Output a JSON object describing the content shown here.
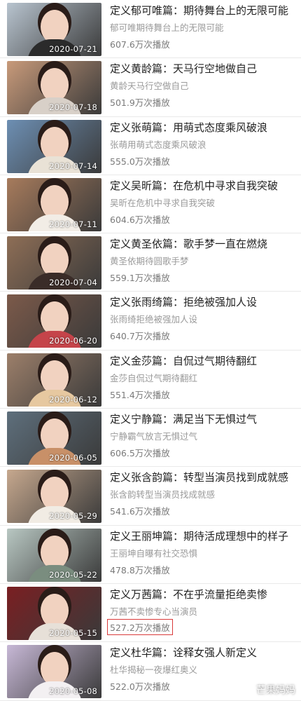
{
  "items": [
    {
      "title": "定义郁可唯篇：期待舞台上的无限可能",
      "subtitle": "郁可唯期待舞台上的无限可能",
      "views": "607.6万次播放",
      "date": "2020-07-21",
      "bg": "#b8c4cf",
      "cloth": "#2b2b2b"
    },
    {
      "title": "定义黄龄篇：天马行空地做自己",
      "subtitle": "黄龄天马行空做自己",
      "views": "501.9万次播放",
      "date": "2020-07-18",
      "bg": "#c89a7a",
      "cloth": "#d8d0c8"
    },
    {
      "title": "定义张萌篇：用萌式态度乘风破浪",
      "subtitle": "张萌用萌式态度乘风破浪",
      "views": "555.0万次播放",
      "date": "2020-07-14",
      "bg": "#6d8fb3",
      "cloth": "#e9e2d6"
    },
    {
      "title": "定义吴昕篇：在危机中寻求自我突破",
      "subtitle": "吴昕在危机中寻求自我突破",
      "views": "604.6万次播放",
      "date": "2020-07-11",
      "bg": "#a77b5c",
      "cloth": "#f2ede6"
    },
    {
      "title": "定义黄圣依篇：歌手梦一直在燃烧",
      "subtitle": "黄圣依期待圆歌手梦",
      "views": "559.1万次播放",
      "date": "2020-07-04",
      "bg": "#8e6e56",
      "cloth": "#3a2c28"
    },
    {
      "title": "定义张雨绮篇：拒绝被强加人设",
      "subtitle": "张雨绮拒绝被强加人设",
      "views": "640.7万次播放",
      "date": "2020-06-20",
      "bg": "#7c5a4a",
      "cloth": "#c5444a"
    },
    {
      "title": "定义金莎篇：自侃过气期待翻红",
      "subtitle": "金莎自侃过气期待翻红",
      "views": "551.4万次播放",
      "date": "2020-06-12",
      "bg": "#9c7f6a",
      "cloth": "#e6c8a0"
    },
    {
      "title": "定义宁静篇：满足当下无惧过气",
      "subtitle": "宁静霸气放言无惧过气",
      "views": "606.5万次播放",
      "date": "2020-06-05",
      "bg": "#5e6f7c",
      "cloth": "#c89068"
    },
    {
      "title": "定义张含韵篇：转型当演员找到成就感",
      "subtitle": "张含韵转型当演员找成就感",
      "views": "541.6万次播放",
      "date": "2020-05-29",
      "bg": "#c6a88e",
      "cloth": "#f1ece4"
    },
    {
      "title": "定义王丽坤篇：期待活成理想中的样子",
      "subtitle": "王丽坤自曝有社交恐惧",
      "views": "478.8万次播放",
      "date": "2020-05-22",
      "bg": "#b8c7c2",
      "cloth": "#7a8d7f"
    },
    {
      "title": "定义万茜篇：不在乎流量拒绝卖惨",
      "subtitle": "万茜不卖惨专心当演员",
      "views": "527.2万次播放",
      "date": "2020-05-15",
      "bg": "#7a1f22",
      "cloth": "#e7e0d8",
      "highlight": true
    },
    {
      "title": "定义杜华篇：诠释女强人新定义",
      "subtitle": "杜华揭秘一夜爆红奥义",
      "views": "522.0万次播放",
      "date": "2020-05-08",
      "bg": "#c7b8d6",
      "cloth": "#f3f0f2"
    }
  ],
  "watermark": "芒果妈妈"
}
